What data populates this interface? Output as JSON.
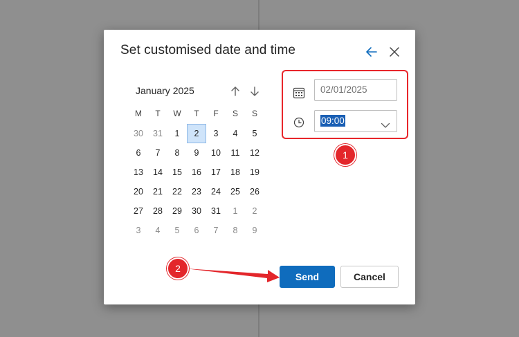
{
  "dialog": {
    "title": "Set customised date and time",
    "back_icon": "arrow-left-icon",
    "close_icon": "close-icon"
  },
  "calendar": {
    "month_label": "January 2025",
    "weekdays": [
      "M",
      "T",
      "W",
      "T",
      "F",
      "S",
      "S"
    ],
    "days": [
      {
        "label": "30",
        "muted": true
      },
      {
        "label": "31",
        "muted": true
      },
      {
        "label": "1"
      },
      {
        "label": "2",
        "selected": true
      },
      {
        "label": "3"
      },
      {
        "label": "4"
      },
      {
        "label": "5"
      },
      {
        "label": "6"
      },
      {
        "label": "7"
      },
      {
        "label": "8"
      },
      {
        "label": "9"
      },
      {
        "label": "10"
      },
      {
        "label": "11"
      },
      {
        "label": "12"
      },
      {
        "label": "13"
      },
      {
        "label": "14"
      },
      {
        "label": "15"
      },
      {
        "label": "16"
      },
      {
        "label": "17"
      },
      {
        "label": "18"
      },
      {
        "label": "19"
      },
      {
        "label": "20"
      },
      {
        "label": "21"
      },
      {
        "label": "22"
      },
      {
        "label": "23"
      },
      {
        "label": "24"
      },
      {
        "label": "25"
      },
      {
        "label": "26"
      },
      {
        "label": "27"
      },
      {
        "label": "28"
      },
      {
        "label": "29"
      },
      {
        "label": "30"
      },
      {
        "label": "31"
      },
      {
        "label": "1",
        "muted": true
      },
      {
        "label": "2",
        "muted": true
      },
      {
        "label": "3",
        "muted": true
      },
      {
        "label": "4",
        "muted": true
      },
      {
        "label": "5",
        "muted": true
      },
      {
        "label": "6",
        "muted": true
      },
      {
        "label": "7",
        "muted": true
      },
      {
        "label": "8",
        "muted": true
      },
      {
        "label": "9",
        "muted": true
      }
    ]
  },
  "fields": {
    "date_value": "02/01/2025",
    "time_value": "09:00"
  },
  "buttons": {
    "send": "Send",
    "cancel": "Cancel"
  },
  "annotations": {
    "badge_1": "1",
    "badge_2": "2",
    "color": "#e3262b"
  },
  "colors": {
    "accent": "#0f6cbd",
    "selected_day_bg": "#cfe4fa"
  }
}
